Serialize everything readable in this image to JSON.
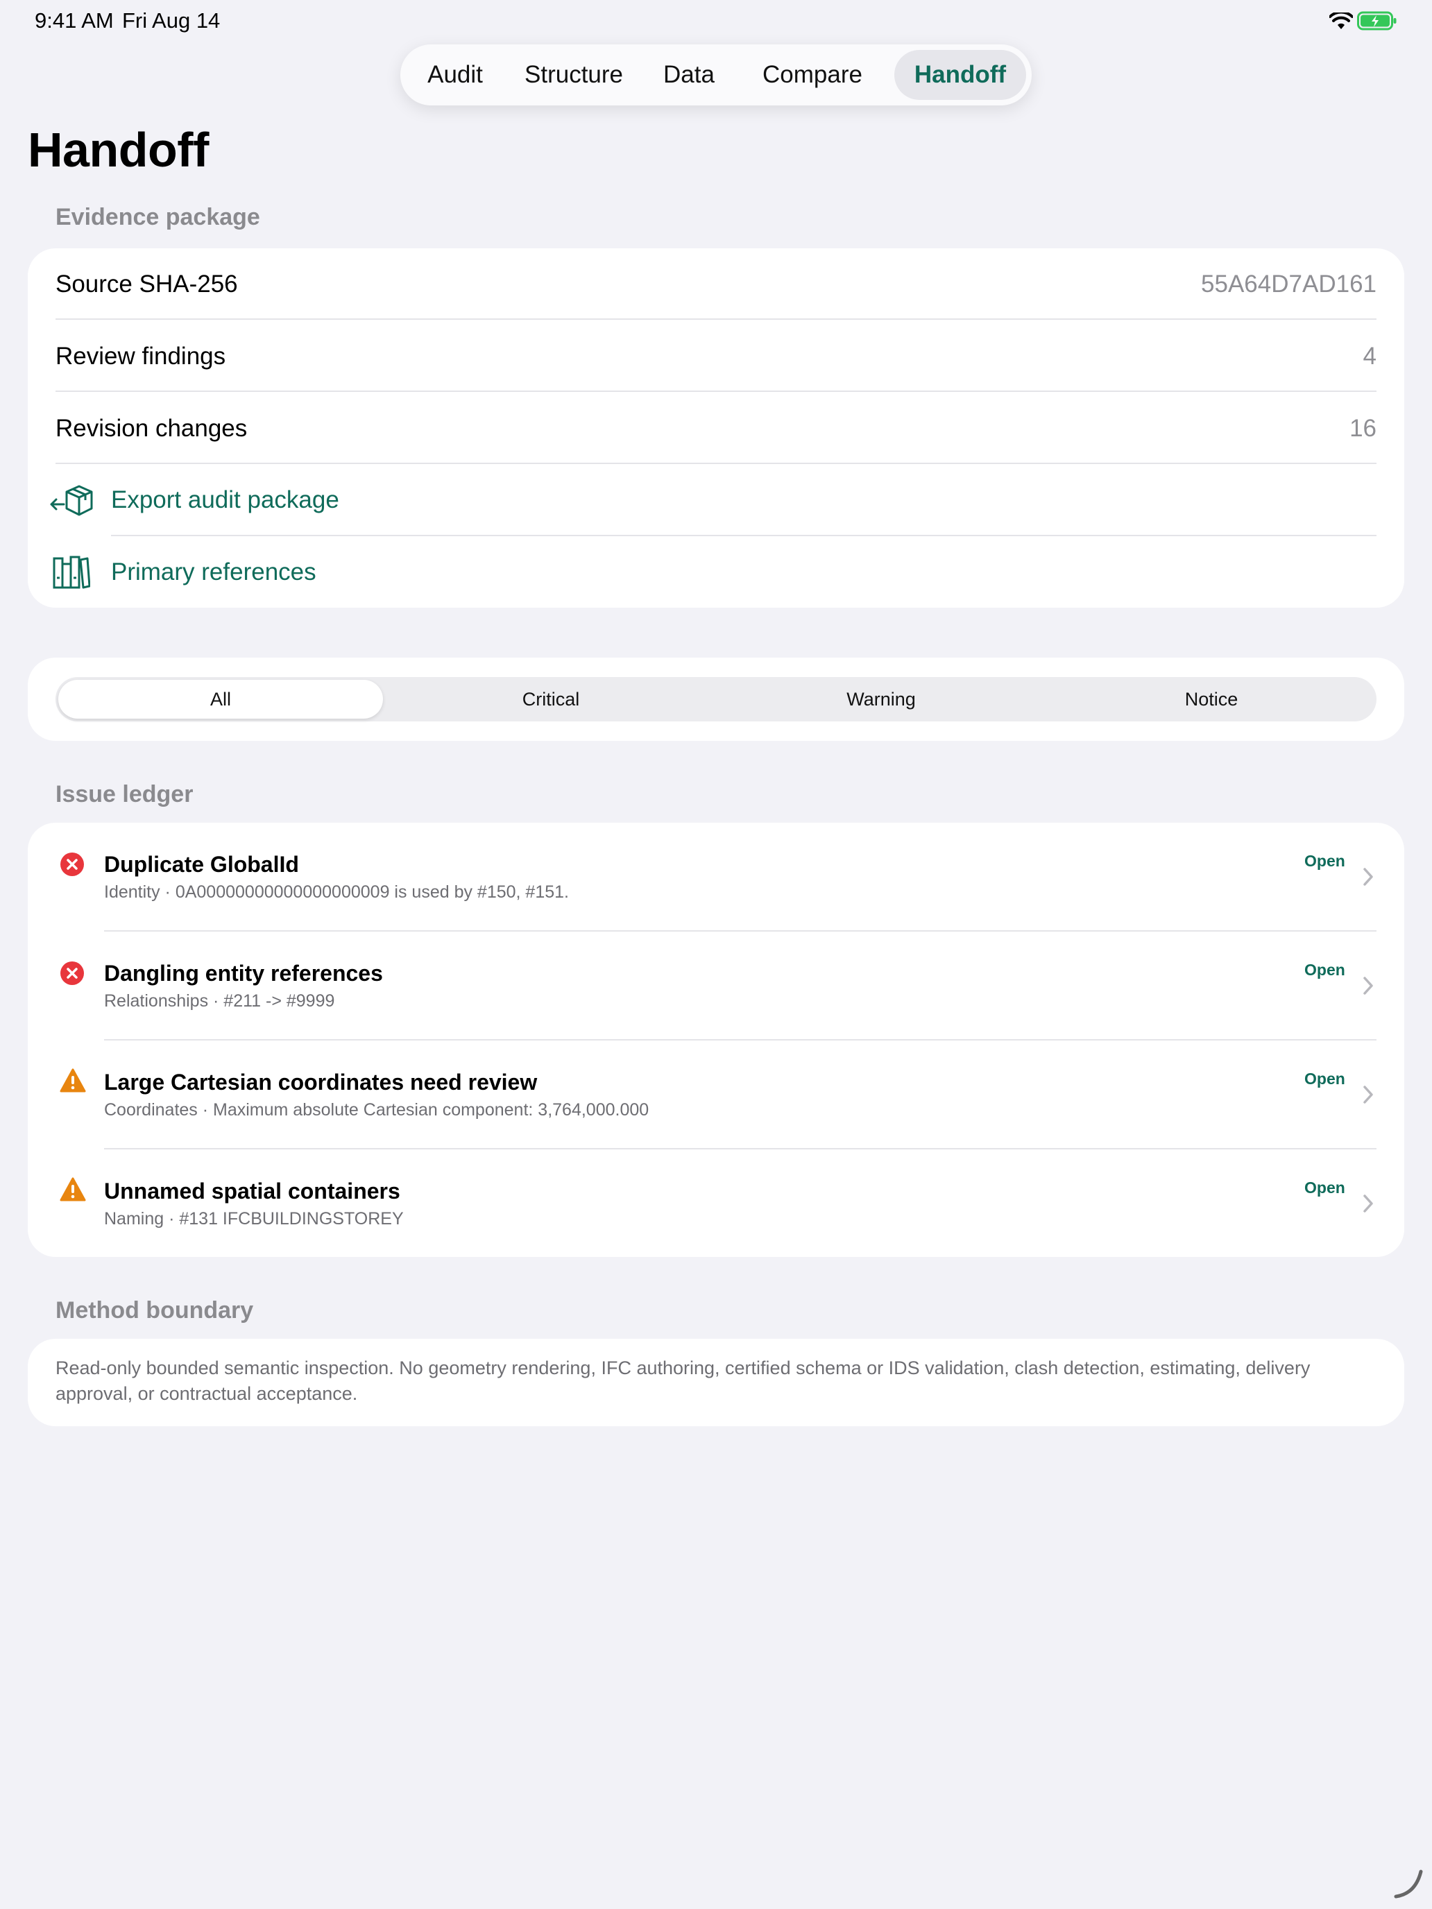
{
  "status_bar": {
    "time": "9:41 AM",
    "date": "Fri Aug 14"
  },
  "tabs": [
    {
      "label": "Audit",
      "active": false
    },
    {
      "label": "Structure",
      "active": false
    },
    {
      "label": "Data",
      "active": false
    },
    {
      "label": "Compare",
      "active": false
    },
    {
      "label": "Handoff",
      "active": true
    }
  ],
  "page": {
    "title": "Handoff"
  },
  "evidence": {
    "header": "Evidence package",
    "rows": [
      {
        "label": "Source SHA-256",
        "value": "55A64D7AD161"
      },
      {
        "label": "Review findings",
        "value": "4"
      },
      {
        "label": "Revision changes",
        "value": "16"
      }
    ],
    "actions": [
      {
        "label": "Export audit package",
        "icon": "box-export-icon"
      },
      {
        "label": "Primary references",
        "icon": "books-icon"
      }
    ]
  },
  "filter": {
    "options": [
      "All",
      "Critical",
      "Warning",
      "Notice"
    ],
    "selected": "All"
  },
  "issues": {
    "header": "Issue ledger",
    "items": [
      {
        "title": "Duplicate GlobalId",
        "subtitle": "Identity · 0A00000000000000000009 is used by #150, #151.",
        "status": "Open",
        "severity": "critical"
      },
      {
        "title": "Dangling entity references",
        "subtitle": "Relationships · #211 -> #9999",
        "status": "Open",
        "severity": "critical"
      },
      {
        "title": "Large Cartesian coordinates need review",
        "subtitle": "Coordinates · Maximum absolute Cartesian component: 3,764,000.000",
        "status": "Open",
        "severity": "warning"
      },
      {
        "title": "Unnamed spatial containers",
        "subtitle": "Naming · #131 IFCBUILDINGSTOREY",
        "status": "Open",
        "severity": "warning"
      }
    ]
  },
  "method": {
    "header": "Method boundary",
    "text": "Read-only bounded semantic inspection. No geometry rendering, IFC authoring, certified schema or IDS validation, clash detection, estimating, delivery approval, or contractual acceptance."
  },
  "colors": {
    "accent": "#0f6b5a",
    "critical": "#e8363c",
    "warning": "#e8850f",
    "battery": "#34c759"
  }
}
